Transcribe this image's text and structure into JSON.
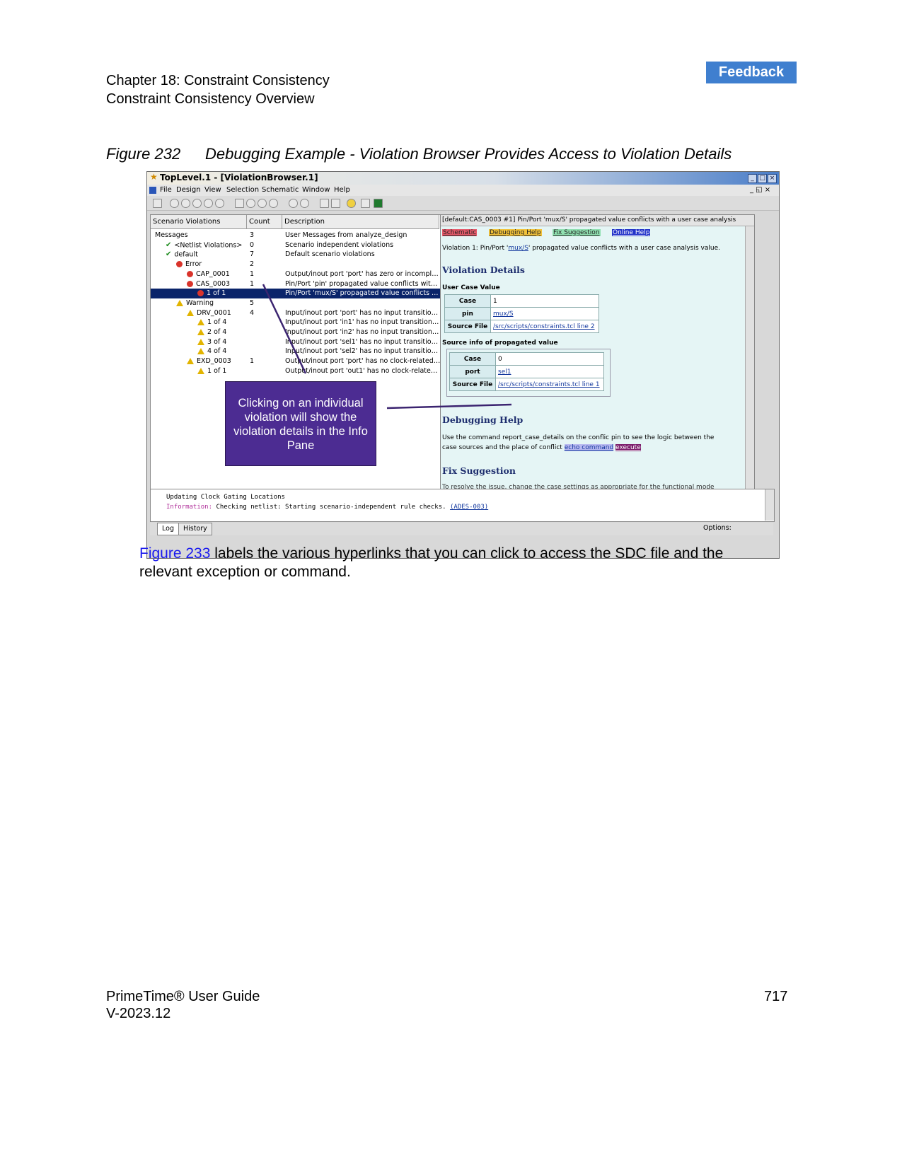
{
  "header": {
    "feedback_label": "Feedback",
    "chapter": "Chapter 18: Constraint Consistency",
    "section": "Constraint Consistency Overview"
  },
  "figure": {
    "number": "Figure 232",
    "title": "Debugging Example - Violation Browser Provides Access to Violation Details"
  },
  "app": {
    "window_title": "TopLevel.1 - [ViolationBrowser.1]",
    "menu": [
      "File",
      "Design",
      "View",
      "Selection",
      "Schematic",
      "Window",
      "Help"
    ],
    "columns": [
      "Scenario Violations",
      "Count",
      "Description"
    ],
    "rows": [
      {
        "name": "Messages",
        "count": "3",
        "desc": "User Messages from analyze_design",
        "indent": 0,
        "icon": ""
      },
      {
        "name": "<Netlist Violations>",
        "count": "0",
        "desc": "Scenario independent violations",
        "indent": 1,
        "icon": "ok"
      },
      {
        "name": "default",
        "count": "7",
        "desc": "Default scenario violations",
        "indent": 1,
        "icon": "ok"
      },
      {
        "name": "Error",
        "count": "2",
        "desc": "",
        "indent": 2,
        "icon": "err"
      },
      {
        "name": "CAP_0001",
        "count": "1",
        "desc": "Output/inout port 'port' has zero or incomplet...",
        "indent": 3,
        "icon": "err"
      },
      {
        "name": "CAS_0003",
        "count": "1",
        "desc": "Pin/Port 'pin' propagated value conflicts with a...",
        "indent": 3,
        "icon": "err"
      },
      {
        "name": "1 of 1",
        "count": "",
        "desc": "Pin/Port 'mux/S' propagated value conflicts wi...",
        "indent": 4,
        "icon": "err",
        "selected": true
      },
      {
        "name": "Warning",
        "count": "5",
        "desc": "",
        "indent": 2,
        "icon": "warn"
      },
      {
        "name": "DRV_0001",
        "count": "4",
        "desc": "Input/inout port 'port' has no input transition. d...",
        "indent": 3,
        "icon": "warn"
      },
      {
        "name": "1 of 4",
        "count": "",
        "desc": "Input/inout port 'in1' has no input transition. dr...",
        "indent": 4,
        "icon": "warn"
      },
      {
        "name": "2 of 4",
        "count": "",
        "desc": "Input/inout port 'in2' has no input transition. dr...",
        "indent": 4,
        "icon": "warn"
      },
      {
        "name": "3 of 4",
        "count": "",
        "desc": "Input/inout port 'sel1' has no input transition. ...",
        "indent": 4,
        "icon": "warn"
      },
      {
        "name": "4 of 4",
        "count": "",
        "desc": "Input/inout port 'sel2' has no input transition. ...",
        "indent": 4,
        "icon": "warn"
      },
      {
        "name": "EXD_0003",
        "count": "1",
        "desc": "Output/inout port 'port' has no clock-related o...",
        "indent": 3,
        "icon": "warn"
      },
      {
        "name": "1 of 1",
        "count": "",
        "desc": "Output/inout port 'out1' has no clock-related ...",
        "indent": 4,
        "icon": "warn"
      }
    ],
    "info": {
      "header": "[default:CAS_0003 #1] Pin/Port 'mux/S' propagated value conflicts with a user case analysis",
      "links": [
        "Schematic",
        "Debugging Help",
        "Fix Suggestion",
        "Online Help"
      ],
      "violation_line_prefix": "Violation 1: Pin/Port '",
      "violation_link": "mux/S",
      "violation_line_suffix": "' propagated value conflicts with a user case analysis value.",
      "details_heading": "Violation Details",
      "user_case_label": "User Case Value",
      "user_case": [
        {
          "k": "Case",
          "v": "1"
        },
        {
          "k": "pin",
          "v": "mux/S"
        },
        {
          "k": "Source File",
          "v": "/src/scripts/constraints.tcl line 2"
        }
      ],
      "source_info_label": "Source info of propagated value",
      "source_info": [
        {
          "k": "Case",
          "v": "0"
        },
        {
          "k": "port",
          "v": "sel1"
        },
        {
          "k": "Source File",
          "v": "/src/scripts/constraints.tcl line 1"
        }
      ],
      "debug_heading": "Debugging Help",
      "debug_text_1": "Use the command report_case_details on the conflic pin to see the logic between the",
      "debug_text_2": "case sources and the place of conflict",
      "echo_link": "echo command",
      "execute_link": "execute",
      "fix_heading": "Fix Suggestion",
      "fix_text": "To resolve the issue, change the case settings as appropriate for the functional mode"
    },
    "console": {
      "line1": "Updating Clock Gating Locations",
      "line2_label": "Information:",
      "line2_text": " Checking netlist: Starting scenario-independent rule checks.",
      "line2_link": "(ADES-003)",
      "tabs": [
        "Log",
        "History"
      ],
      "options": "Options:"
    }
  },
  "callout": {
    "text": "Clicking on an individual violation will show the violation details in the Info Pane"
  },
  "body": {
    "link": "Figure 233",
    "text": " labels the various hyperlinks that you can click to access the SDC file and the relevant exception or command."
  },
  "footer": {
    "guide": "PrimeTime® User Guide",
    "version": "V-2023.12",
    "page": "717"
  }
}
